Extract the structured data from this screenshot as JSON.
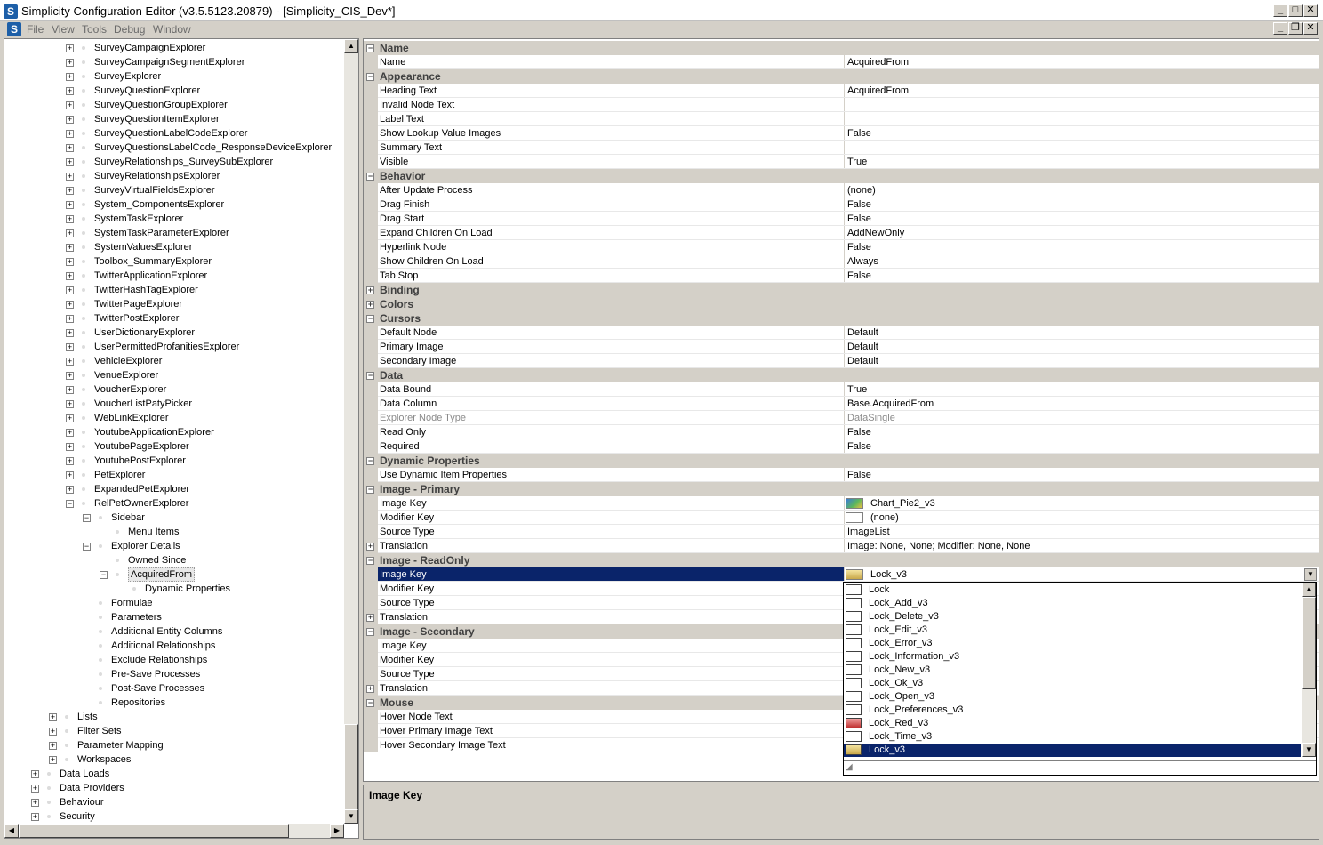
{
  "window": {
    "title": "Simplicity Configuration Editor (v3.5.5123.20879) - [Simplicity_CIS_Dev*]",
    "icon_letter": "S",
    "minimize": "_",
    "maximize": "□",
    "close": "✕",
    "restore": "❐"
  },
  "menu": [
    "File",
    "View",
    "Tools",
    "Debug",
    "Window"
  ],
  "tree": {
    "items": [
      {
        "label": "SurveyCampaignExplorer",
        "level": 3,
        "exp": "+"
      },
      {
        "label": "SurveyCampaignSegmentExplorer",
        "level": 3,
        "exp": "+"
      },
      {
        "label": "SurveyExplorer",
        "level": 3,
        "exp": "+"
      },
      {
        "label": "SurveyQuestionExplorer",
        "level": 3,
        "exp": "+"
      },
      {
        "label": "SurveyQuestionGroupExplorer",
        "level": 3,
        "exp": "+"
      },
      {
        "label": "SurveyQuestionItemExplorer",
        "level": 3,
        "exp": "+"
      },
      {
        "label": "SurveyQuestionLabelCodeExplorer",
        "level": 3,
        "exp": "+"
      },
      {
        "label": "SurveyQuestionsLabelCode_ResponseDeviceExplorer",
        "level": 3,
        "exp": "+"
      },
      {
        "label": "SurveyRelationships_SurveySubExplorer",
        "level": 3,
        "exp": "+"
      },
      {
        "label": "SurveyRelationshipsExplorer",
        "level": 3,
        "exp": "+"
      },
      {
        "label": "SurveyVirtualFieldsExplorer",
        "level": 3,
        "exp": "+"
      },
      {
        "label": "System_ComponentsExplorer",
        "level": 3,
        "exp": "+"
      },
      {
        "label": "SystemTaskExplorer",
        "level": 3,
        "exp": "+"
      },
      {
        "label": "SystemTaskParameterExplorer",
        "level": 3,
        "exp": "+"
      },
      {
        "label": "SystemValuesExplorer",
        "level": 3,
        "exp": "+"
      },
      {
        "label": "Toolbox_SummaryExplorer",
        "level": 3,
        "exp": "+"
      },
      {
        "label": "TwitterApplicationExplorer",
        "level": 3,
        "exp": "+"
      },
      {
        "label": "TwitterHashTagExplorer",
        "level": 3,
        "exp": "+"
      },
      {
        "label": "TwitterPageExplorer",
        "level": 3,
        "exp": "+"
      },
      {
        "label": "TwitterPostExplorer",
        "level": 3,
        "exp": "+"
      },
      {
        "label": "UserDictionaryExplorer",
        "level": 3,
        "exp": "+"
      },
      {
        "label": "UserPermittedProfanitiesExplorer",
        "level": 3,
        "exp": "+"
      },
      {
        "label": "VehicleExplorer",
        "level": 3,
        "exp": "+"
      },
      {
        "label": "VenueExplorer",
        "level": 3,
        "exp": "+"
      },
      {
        "label": "VoucherExplorer",
        "level": 3,
        "exp": "+"
      },
      {
        "label": "VoucherListPatyPicker",
        "level": 3,
        "exp": "+"
      },
      {
        "label": "WebLinkExplorer",
        "level": 3,
        "exp": "+"
      },
      {
        "label": "YoutubeApplicationExplorer",
        "level": 3,
        "exp": "+"
      },
      {
        "label": "YoutubePageExplorer",
        "level": 3,
        "exp": "+"
      },
      {
        "label": "YoutubePostExplorer",
        "level": 3,
        "exp": "+"
      },
      {
        "label": "PetExplorer",
        "level": 3,
        "exp": "+"
      },
      {
        "label": "ExpandedPetExplorer",
        "level": 3,
        "exp": "+"
      },
      {
        "label": "RelPetOwnerExplorer",
        "level": 3,
        "exp": "−"
      },
      {
        "label": "Sidebar",
        "level": 4,
        "exp": "−"
      },
      {
        "label": "Menu Items",
        "level": 5,
        "exp": ""
      },
      {
        "label": "Explorer Details",
        "level": 4,
        "exp": "−"
      },
      {
        "label": "Owned Since",
        "level": 5,
        "exp": ""
      },
      {
        "label": "AcquiredFrom",
        "level": 5,
        "exp": "−",
        "selected": true
      },
      {
        "label": "Dynamic Properties",
        "level": 6,
        "exp": ""
      },
      {
        "label": "Formulae",
        "level": 4,
        "exp": ""
      },
      {
        "label": "Parameters",
        "level": 4,
        "exp": ""
      },
      {
        "label": "Additional Entity Columns",
        "level": 4,
        "exp": ""
      },
      {
        "label": "Additional Relationships",
        "level": 4,
        "exp": ""
      },
      {
        "label": "Exclude Relationships",
        "level": 4,
        "exp": ""
      },
      {
        "label": "Pre-Save Processes",
        "level": 4,
        "exp": ""
      },
      {
        "label": "Post-Save Processes",
        "level": 4,
        "exp": ""
      },
      {
        "label": "Repositories",
        "level": 4,
        "exp": ""
      },
      {
        "label": "Lists",
        "level": 2,
        "exp": "+"
      },
      {
        "label": "Filter Sets",
        "level": 2,
        "exp": "+"
      },
      {
        "label": "Parameter Mapping",
        "level": 2,
        "exp": "+"
      },
      {
        "label": "Workspaces",
        "level": 2,
        "exp": "+"
      },
      {
        "label": "Data Loads",
        "level": 1,
        "exp": "+"
      },
      {
        "label": "Data Providers",
        "level": 1,
        "exp": "+"
      },
      {
        "label": "Behaviour",
        "level": 1,
        "exp": "+"
      },
      {
        "label": "Security",
        "level": 1,
        "exp": "+"
      }
    ]
  },
  "grid": {
    "rows": [
      {
        "type": "cat",
        "name": "Name",
        "exp": "−"
      },
      {
        "name": "Name",
        "value": "AcquiredFrom"
      },
      {
        "type": "cat",
        "name": "Appearance",
        "exp": "−"
      },
      {
        "name": "Heading Text",
        "value": "AcquiredFrom"
      },
      {
        "name": "Invalid Node Text",
        "value": ""
      },
      {
        "name": "Label Text",
        "value": ""
      },
      {
        "name": "Show Lookup Value Images",
        "value": "False"
      },
      {
        "name": "Summary Text",
        "value": ""
      },
      {
        "name": "Visible",
        "value": "True"
      },
      {
        "type": "cat",
        "name": "Behavior",
        "exp": "−"
      },
      {
        "name": "After Update Process",
        "value": "(none)"
      },
      {
        "name": "Drag Finish",
        "value": "False"
      },
      {
        "name": "Drag Start",
        "value": "False"
      },
      {
        "name": "Expand Children On Load",
        "value": "AddNewOnly"
      },
      {
        "name": "Hyperlink Node",
        "value": "False"
      },
      {
        "name": "Show Children On Load",
        "value": "Always"
      },
      {
        "name": "Tab Stop",
        "value": "False"
      },
      {
        "type": "cat",
        "name": "Binding",
        "exp": "+"
      },
      {
        "type": "cat",
        "name": "Colors",
        "exp": "+"
      },
      {
        "type": "cat",
        "name": "Cursors",
        "exp": "−"
      },
      {
        "name": "Default Node",
        "value": "Default"
      },
      {
        "name": "Primary Image",
        "value": "Default"
      },
      {
        "name": "Secondary Image",
        "value": "Default"
      },
      {
        "type": "cat",
        "name": "Data",
        "exp": "−"
      },
      {
        "name": "Data Bound",
        "value": "True"
      },
      {
        "name": "Data Column",
        "value": "Base.AcquiredFrom"
      },
      {
        "name": "Explorer Node Type",
        "value": "DataSingle",
        "dim": true
      },
      {
        "name": "Read Only",
        "value": "False"
      },
      {
        "name": "Required",
        "value": "False"
      },
      {
        "type": "cat",
        "name": "Dynamic Properties",
        "exp": "−"
      },
      {
        "name": "Use Dynamic Item Properties",
        "value": "False"
      },
      {
        "type": "cat",
        "name": "Image - Primary",
        "exp": "−"
      },
      {
        "name": "Image Key",
        "value": "Chart_Pie2_v3",
        "swatch": "chart"
      },
      {
        "name": "Modifier Key",
        "value": "(none)",
        "swatch": "blank"
      },
      {
        "name": "Source Type",
        "value": "ImageList"
      },
      {
        "name": "Translation",
        "value": "Image: None, None; Modifier: None, None",
        "exp": "+"
      },
      {
        "type": "cat",
        "name": "Image - ReadOnly",
        "exp": "−"
      },
      {
        "name": "Image Key",
        "value": "Lock_v3",
        "swatch": "lock",
        "selected": true
      },
      {
        "name": "Modifier Key",
        "value": ""
      },
      {
        "name": "Source Type",
        "value": ""
      },
      {
        "name": "Translation",
        "value": "",
        "exp": "+"
      },
      {
        "type": "cat",
        "name": "Image - Secondary",
        "exp": "−"
      },
      {
        "name": "Image Key",
        "value": ""
      },
      {
        "name": "Modifier Key",
        "value": ""
      },
      {
        "name": "Source Type",
        "value": ""
      },
      {
        "name": "Translation",
        "value": "",
        "exp": "+"
      },
      {
        "type": "cat",
        "name": "Mouse",
        "exp": "−"
      },
      {
        "name": "Hover Node Text",
        "value": ""
      },
      {
        "name": "Hover Primary Image Text",
        "value": ""
      },
      {
        "name": "Hover Secondary Image Text",
        "value": ""
      }
    ]
  },
  "dropdown": {
    "items": [
      {
        "label": "Lock"
      },
      {
        "label": "Lock_Add_v3"
      },
      {
        "label": "Lock_Delete_v3"
      },
      {
        "label": "Lock_Edit_v3"
      },
      {
        "label": "Lock_Error_v3"
      },
      {
        "label": "Lock_Information_v3"
      },
      {
        "label": "Lock_New_v3"
      },
      {
        "label": "Lock_Ok_v3"
      },
      {
        "label": "Lock_Open_v3"
      },
      {
        "label": "Lock_Preferences_v3"
      },
      {
        "label": "Lock_Red_v3",
        "icon": "red"
      },
      {
        "label": "Lock_Time_v3"
      },
      {
        "label": "Lock_v3",
        "selected": true,
        "icon": "lock"
      }
    ]
  },
  "description": {
    "title": "Image Key"
  },
  "colors": {
    "selection": "#0a246a",
    "chrome": "#d4d0c8"
  }
}
